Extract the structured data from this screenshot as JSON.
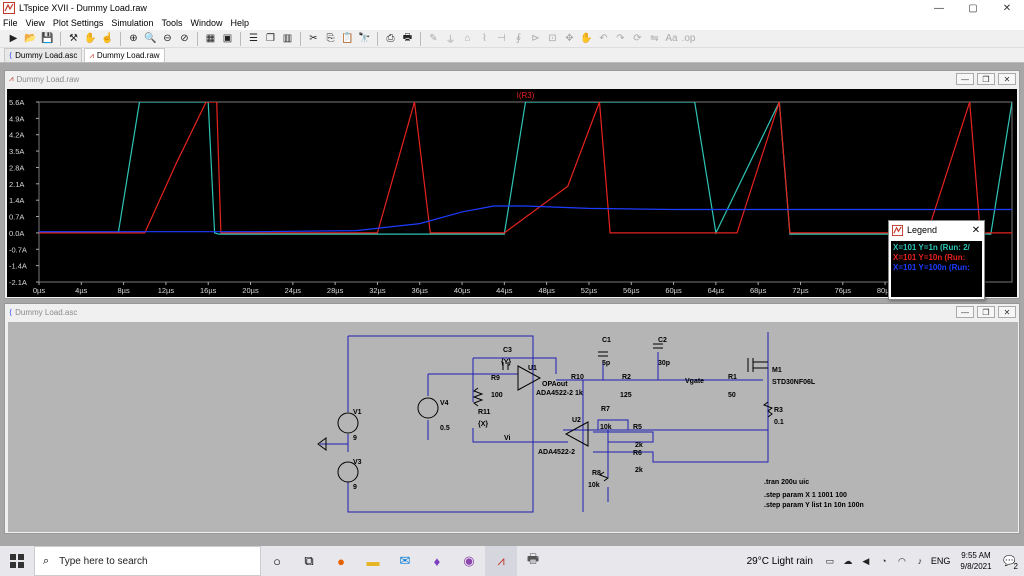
{
  "window": {
    "title": "LTspice XVII - Dummy Load.raw",
    "min": "—",
    "max": "▢",
    "close": "✕"
  },
  "menu": [
    "File",
    "View",
    "Plot Settings",
    "Simulation",
    "Tools",
    "Window",
    "Help"
  ],
  "doc_tabs": [
    {
      "label": "Dummy Load.asc",
      "active": false
    },
    {
      "label": "Dummy Load.raw",
      "active": true
    }
  ],
  "wave_window": {
    "title": "Dummy Load.raw",
    "trace_title": "I(R3)"
  },
  "schematic_window": {
    "title": "Dummy Load.asc"
  },
  "colors": {
    "teal": "#2ec4b6",
    "red": "#e6231e",
    "blue": "#1e3cff",
    "grid_text": "#d9d9d9",
    "wire": "#1e1eb4"
  },
  "chart_data": {
    "type": "line",
    "title": "I(R3)",
    "xlabel": "",
    "ylabel": "",
    "x_ticks": [
      "0µs",
      "4µs",
      "8µs",
      "12µs",
      "16µs",
      "20µs",
      "24µs",
      "28µs",
      "32µs",
      "36µs",
      "40µs",
      "44µs",
      "48µs",
      "52µs",
      "56µs",
      "60µs",
      "64µs",
      "68µs",
      "72µs",
      "76µs",
      "80µs",
      "84µs",
      "88µs"
    ],
    "y_ticks": [
      "5.6A",
      "4.9A",
      "4.2A",
      "3.5A",
      "2.8A",
      "2.1A",
      "1.4A",
      "0.7A",
      "0.0A",
      "-0.7A",
      "-1.4A",
      "-2.1A"
    ],
    "xlim": [
      0,
      92
    ],
    "ylim": [
      -2.1,
      5.6
    ],
    "grid": false,
    "series": [
      {
        "name": "X=101 Y=1n",
        "color": "#2ec4b6",
        "x": [
          0,
          7.5,
          9.5,
          16,
          16.6,
          17,
          44,
          46,
          62,
          64,
          70,
          71,
          90,
          92
        ],
        "y": [
          0,
          0,
          5.6,
          5.6,
          0,
          -0.05,
          -0.05,
          5.6,
          5.6,
          0,
          5.6,
          -0.05,
          -0.05,
          5.6
        ]
      },
      {
        "name": "X=101 Y=10n",
        "color": "#e6231e",
        "x": [
          0,
          10,
          13,
          15.8,
          16.8,
          17.2,
          32,
          35.5,
          37,
          44,
          50,
          53,
          54,
          66,
          70,
          71,
          84,
          88,
          89,
          92
        ],
        "y": [
          0,
          0,
          3.0,
          5.6,
          5.6,
          0,
          0,
          5.6,
          0,
          0,
          2.0,
          5.6,
          0,
          0,
          5.6,
          0,
          0,
          5.6,
          0,
          0
        ]
      },
      {
        "name": "X=101 Y=100n",
        "color": "#1e3cff",
        "x": [
          0,
          20,
          30,
          36,
          40,
          43,
          46,
          52,
          60,
          70,
          80,
          92
        ],
        "y": [
          0.05,
          0.05,
          0.1,
          0.4,
          0.9,
          1.15,
          1.15,
          1.05,
          1.0,
          1.0,
          1.0,
          1.0
        ]
      }
    ]
  },
  "legend": {
    "title": "Legend",
    "entries": [
      {
        "text": "X=101 Y=1n  (Run: 2/",
        "color": "#2ec4b6"
      },
      {
        "text": "X=101 Y=10n  (Run:",
        "color": "#e6231e"
      },
      {
        "text": "X=101 Y=100n  (Run:",
        "color": "#1e3cff"
      }
    ]
  },
  "schematic": {
    "labels": {
      "c3": "C3",
      "c3v": "{Y}",
      "u1": "U1",
      "opaout": "OPAout",
      "u1part": "ADA4522-2",
      "r9": "R9",
      "r9v": "100",
      "r10": "R10",
      "r10v": "1k",
      "c1": "C1",
      "c1v": "5p",
      "c2": "C2",
      "c2v": "30p",
      "r2": "R2",
      "r2v": "125",
      "vgate": "Vgate",
      "r1": "R1",
      "r1v": "50",
      "m1": "M1",
      "m1part": "STD30NF06L",
      "r3": "R3",
      "r3v": "0.1",
      "v4": "V4",
      "v4v": "0.5",
      "r11": "R11",
      "r11v": "{X}",
      "vi": "Vi",
      "r7": "R7",
      "r7v": "10k",
      "u2": "U2",
      "u2part": "ADA4522-2",
      "r5": "R5",
      "r5v": "2k",
      "r6": "R6",
      "r6v": "2k",
      "r8": "R8",
      "r8v": "10k",
      "v1": "V1",
      "v1v": "9",
      "v3": "V3",
      "v3v": "9"
    },
    "directives": [
      ".tran 200u uic",
      ".step param X 1 1001 100",
      ".step param Y list 1n 10n 100n"
    ]
  },
  "taskbar": {
    "search_placeholder": "Type here to search",
    "weather": "29°C  Light rain",
    "lang": "ENG",
    "time": "9:55 AM",
    "date": "9/8/2021",
    "notification_count": "2"
  }
}
